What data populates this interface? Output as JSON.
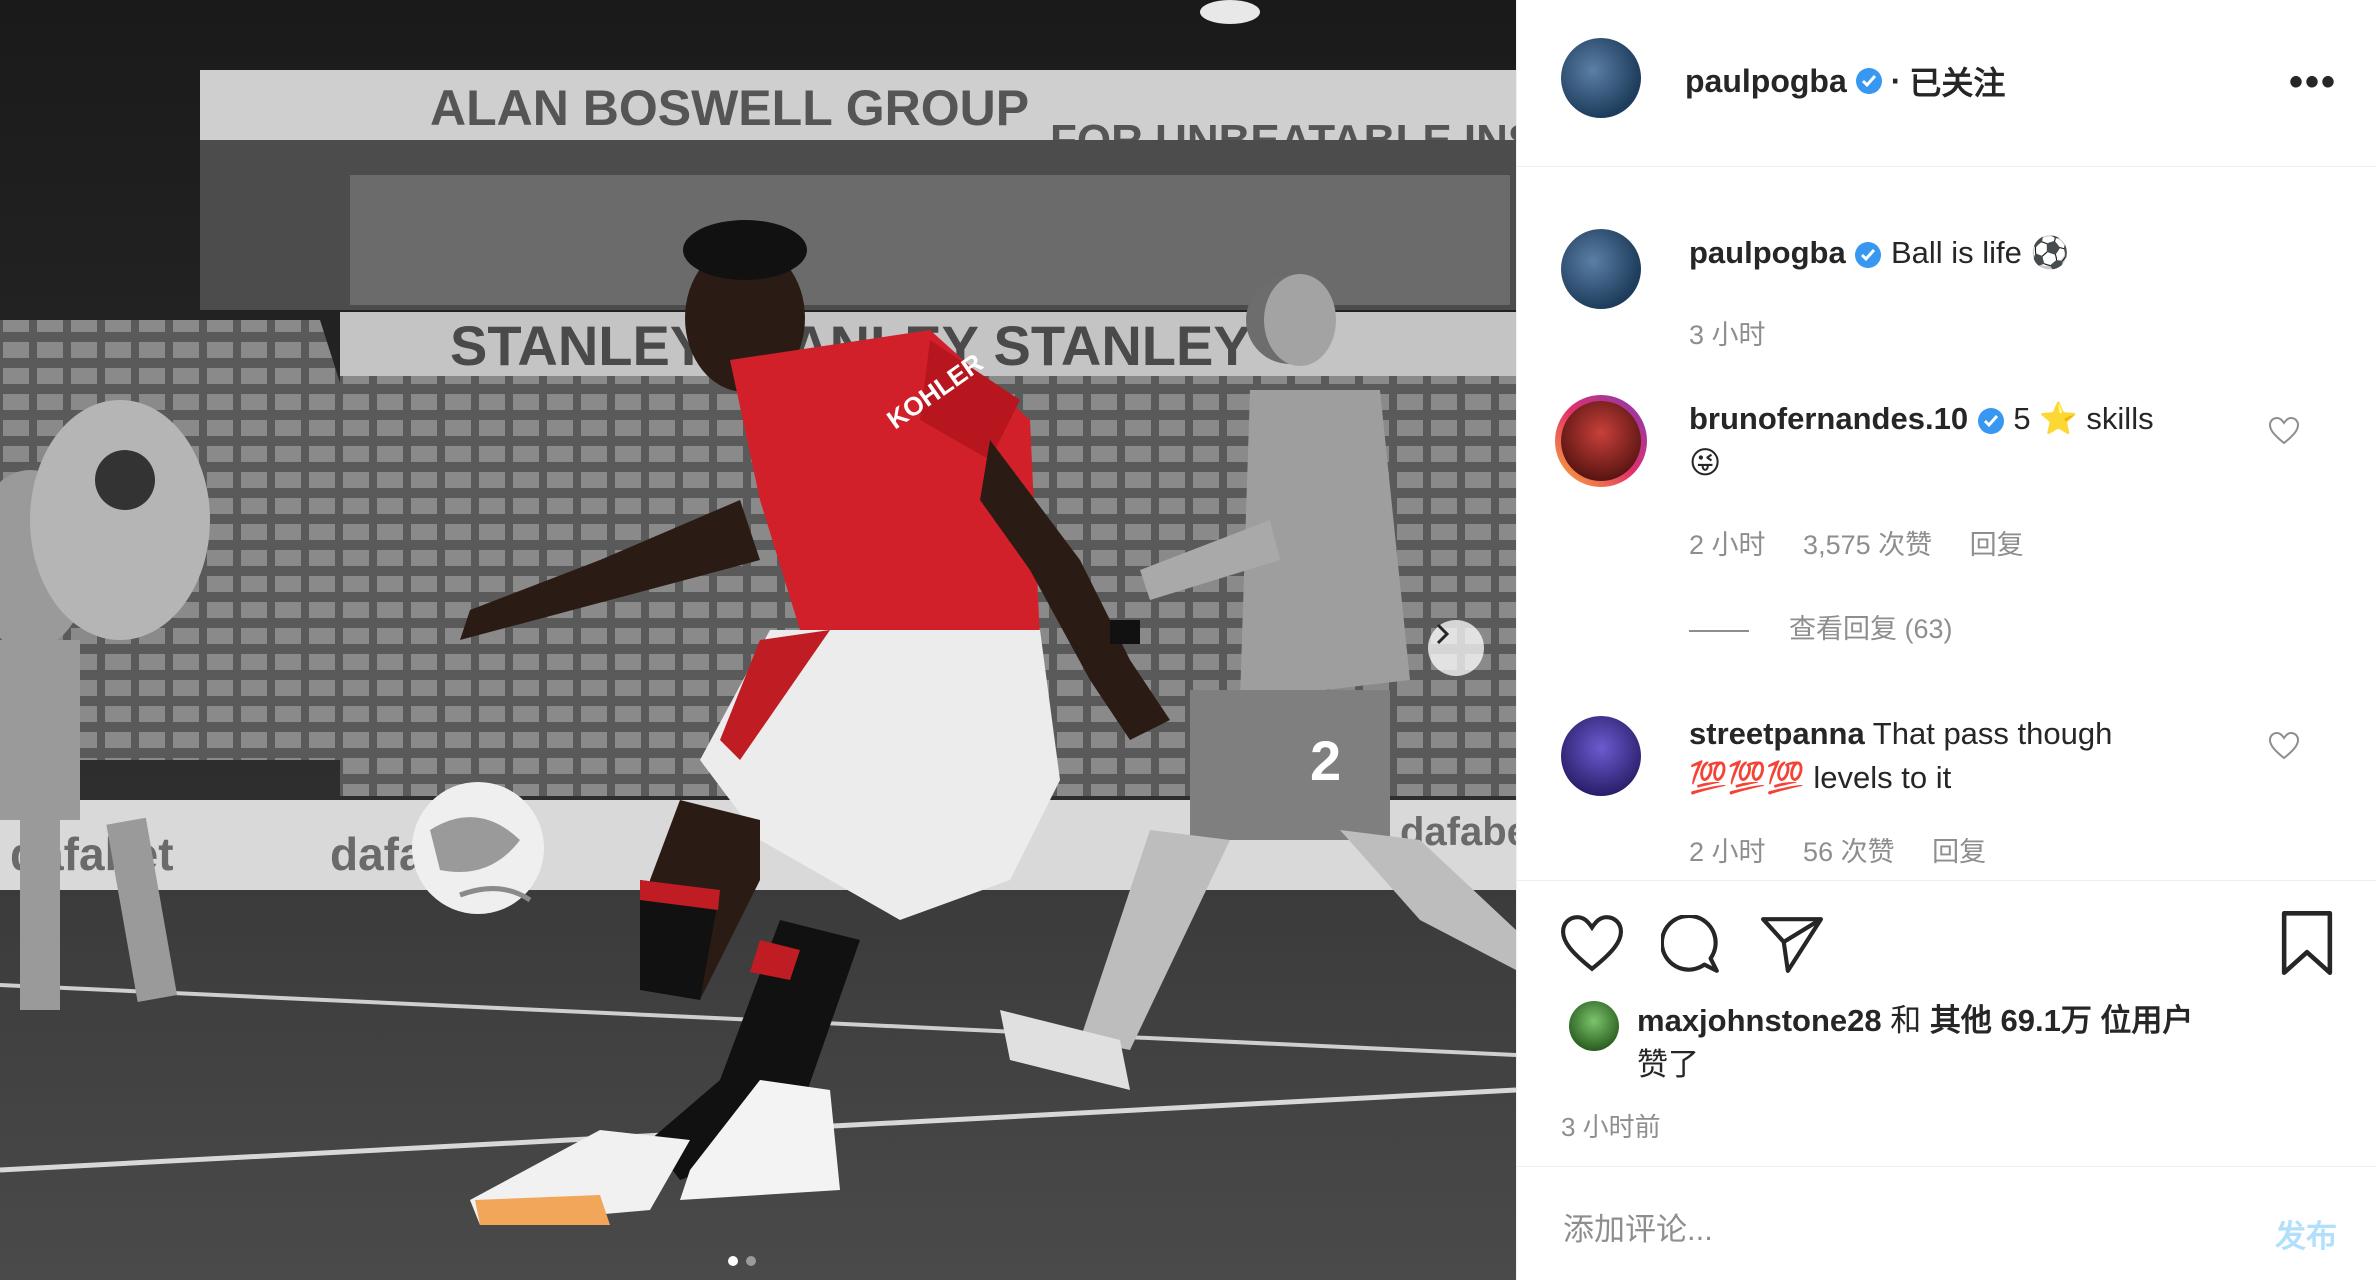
{
  "photo": {
    "banner_top": "ALAN BOSWELL GROUP",
    "banner_top_right": "FOR UNBEATABLE INSU",
    "stand_name": "STANLEY  STANLEY  STANLEY",
    "sponsor_shirt": "KOHLER",
    "board_left": "dafabet",
    "board_mid": "dafabet",
    "board_right": "dafabet",
    "player_number": "2",
    "image_count": 2,
    "active_index": 0
  },
  "header": {
    "username": "paulpogba",
    "separator": "·",
    "follow_status": "已关注",
    "more_icon": "more-dots-icon"
  },
  "caption": {
    "username": "paulpogba",
    "text": "Ball is life",
    "emoji": "⚽",
    "time": "3 小时"
  },
  "comments": [
    {
      "username": "brunofernandes.10",
      "text_a": "5",
      "emoji_a": "⭐",
      "text_b": "skills",
      "emoji_b": "😜",
      "time": "2 小时",
      "likes": "3,575 次赞",
      "reply_label": "回复",
      "view_replies": "查看回复 (63)"
    },
    {
      "username": "streetpanna",
      "text_a": "That pass though",
      "emoji_a": "💯💯💯",
      "text_b": "levels to it",
      "time": "2 小时",
      "likes": "56 次赞",
      "reply_label": "回复"
    }
  ],
  "actions": {
    "like_icon": "heart-icon",
    "comment_icon": "comment-icon",
    "share_icon": "send-icon",
    "save_icon": "bookmark-icon",
    "liked_by_user": "maxjohnstone28",
    "liked_by_mid": "和",
    "liked_by_others": "其他 69.1万 位用户",
    "liked_by_suffix": "赞了",
    "time_ago": "3 小时前"
  },
  "add_comment": {
    "placeholder": "添加评论...",
    "post_label": "发布"
  }
}
